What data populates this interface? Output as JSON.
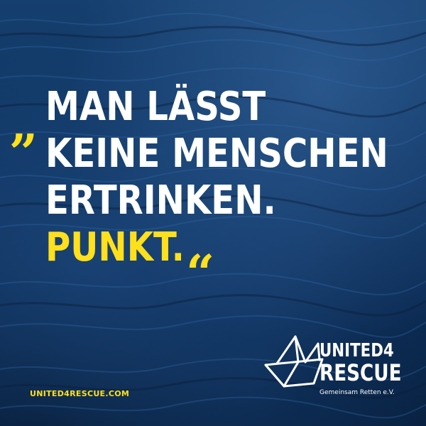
{
  "quote": {
    "open_mark": "„",
    "lines": [
      "MAN LÄSST",
      "KEINE MENSCHEN",
      "ERTRINKEN."
    ],
    "accent_line": "PUNKT.",
    "close_mark": "“"
  },
  "footer": {
    "website": "UNITED4RESCUE.COM"
  },
  "logo": {
    "line1_text": "UNITED",
    "line1_number": "4",
    "line2_text": "RESCUE",
    "tagline": "Gemeinsam Retten e.V."
  },
  "colors": {
    "accent": "#ffe01a",
    "text": "#ffffff",
    "background": "#0f3461"
  },
  "icons": {
    "logo_mark": "paper-boat-icon"
  }
}
